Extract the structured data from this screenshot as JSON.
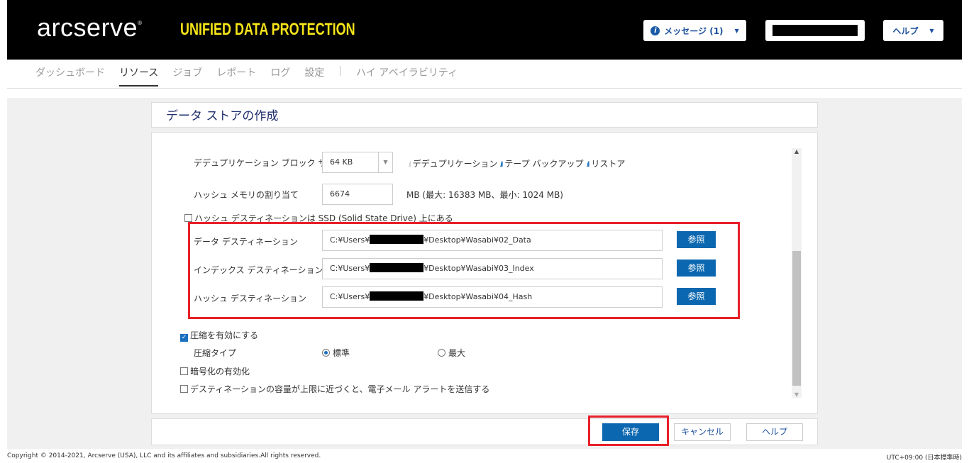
{
  "header": {
    "logo": "arcserve",
    "logo_mark": "®",
    "tagline": "UNIFIED DATA PROTECTION",
    "messages_label": "メッセージ (1)",
    "help_label": "ヘルプ"
  },
  "nav": {
    "items": [
      "ダッシュボード",
      "リソース",
      "ジョブ",
      "レポート",
      "ログ",
      "設定",
      "ハイ アベイラビリティ"
    ],
    "active": "リソース"
  },
  "page": {
    "title": "データ ストアの作成"
  },
  "form": {
    "block_size_label": "デデュプリケーション ブロック サイズ",
    "block_size_value": "64 KB",
    "legend": [
      "デデュプリケーション",
      "テープ バックアップ",
      "リストア"
    ],
    "hash_mem_label": "ハッシュ メモリの割り当て",
    "hash_mem_value": "6674",
    "hash_mem_note": "MB (最大: 16383 MB、最小: 1024 MB)",
    "ssd_label": "ハッシュ デスティネーションは SSD (Solid State Drive) 上にある",
    "ssd_checked": false,
    "destinations": [
      {
        "label": "データ デスティネーション",
        "prefix": "C:¥Users¥",
        "suffix": "¥Desktop¥Wasabi¥02_Data",
        "browse": "参照"
      },
      {
        "label": "インデックス デスティネーション",
        "prefix": "C:¥Users¥",
        "suffix": "¥Desktop¥Wasabi¥03_Index",
        "browse": "参照"
      },
      {
        "label": "ハッシュ デスティネーション",
        "prefix": "C:¥Users¥",
        "suffix": "¥Desktop¥Wasabi¥04_Hash",
        "browse": "参照"
      }
    ],
    "compress_label": "圧縮を有効にする",
    "compress_checked": true,
    "compress_type_label": "圧縮タイプ",
    "compress_standard": "標準",
    "compress_max": "最大",
    "compress_selected": "標準",
    "encrypt_label": "暗号化の有効化",
    "encrypt_checked": false,
    "alert_label": "デスティネーションの容量が上限に近づくと、電子メール アラートを送信する",
    "alert_checked": false
  },
  "footer_buttons": {
    "save": "保存",
    "cancel": "キャンセル",
    "help": "ヘルプ"
  },
  "footer": {
    "copyright": "Copyright © 2014-2021, Arcserve (USA), LLC and its affiliates and subsidiaries.All rights reserved.",
    "timezone": "UTC+09:00 (日本標準時)"
  },
  "colors": {
    "accent": "#0b68b0",
    "highlight": "#e8202a",
    "tagline": "#f5e31a"
  }
}
